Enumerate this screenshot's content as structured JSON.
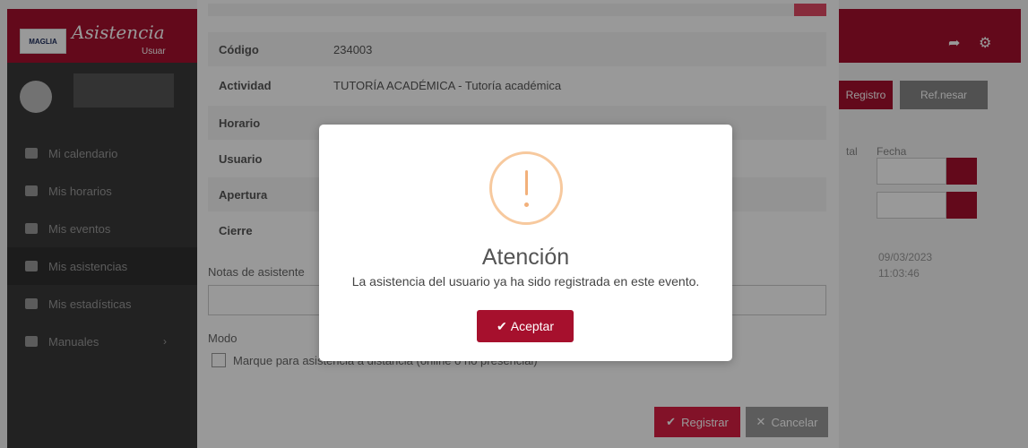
{
  "app": {
    "logo_text": "MAGLIA",
    "brand": "Asistencia",
    "brand_sub": "Usuar"
  },
  "sidebar": {
    "items": [
      {
        "label": "Mi calendario",
        "icon": "calendar-icon"
      },
      {
        "label": "Mis horarios",
        "icon": "schedule-icon"
      },
      {
        "label": "Mis eventos",
        "icon": "bell-icon"
      },
      {
        "label": "Mis asistencias",
        "icon": "history-icon"
      },
      {
        "label": "Mis estadísticas",
        "icon": "chart-icon"
      },
      {
        "label": "Manuales",
        "icon": "book-icon"
      }
    ]
  },
  "background": {
    "registro_button": "Registro",
    "other_button": "Ref.nesar",
    "fecha_label": "Fecha",
    "tal_label": "tal",
    "date_text": "09/03/2023",
    "time_text": "11:03:46"
  },
  "form": {
    "rows": [
      {
        "key": "Código",
        "value": "234003"
      },
      {
        "key": "Actividad",
        "value": "TUTORÍA ACADÉMICA - Tutoría académica"
      },
      {
        "key": "Horario",
        "value": ""
      },
      {
        "key": "Usuario",
        "value": ""
      },
      {
        "key": "Apertura",
        "value": ""
      },
      {
        "key": "Cierre",
        "value": ""
      }
    ],
    "notes_label": "Notas de asistente",
    "mode_label": "Modo",
    "checkbox_label": "Marque para asistencia a distancia (online o no presencial)",
    "register_button": "Registrar",
    "cancel_button": "Cancelar"
  },
  "alert": {
    "title": "Atención",
    "message": "La asistencia del usuario ya ha sido registrada en este evento.",
    "confirm_button": "Aceptar"
  },
  "colors": {
    "brand": "#a6102d",
    "warning": "#f2b07a"
  }
}
